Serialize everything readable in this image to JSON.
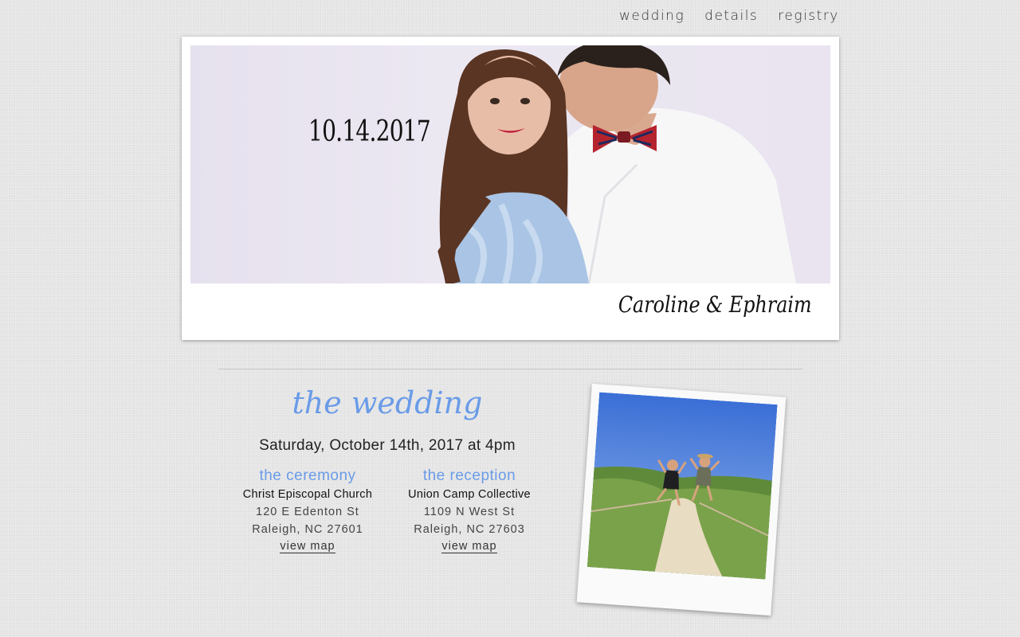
{
  "nav": {
    "items": [
      "wedding",
      "details",
      "registry"
    ]
  },
  "hero": {
    "date": "10.14.2017",
    "names": "Caroline & Ephraim"
  },
  "wedding": {
    "title": "the wedding",
    "datetime": "Saturday, October 14th, 2017 at 4pm",
    "ceremony": {
      "heading": "the ceremony",
      "venue": "Christ Episcopal Church",
      "street": "120 E Edenton St",
      "city": "Raleigh, NC 27601",
      "map_label": "view map"
    },
    "reception": {
      "heading": "the reception",
      "venue": "Union Camp Collective",
      "street": "1109 N West St",
      "city": "Raleigh, NC 27603",
      "map_label": "view map"
    }
  },
  "colors": {
    "accent": "#6a9be8",
    "background": "#e4e4e4"
  }
}
